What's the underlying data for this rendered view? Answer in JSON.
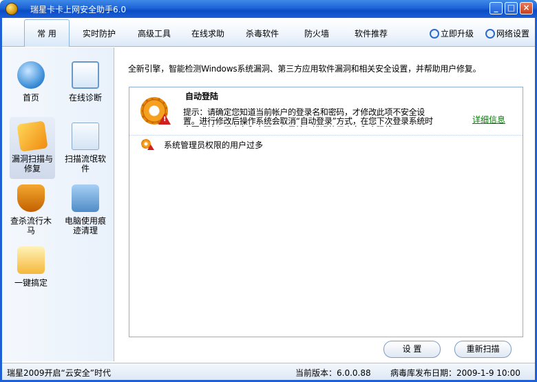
{
  "window": {
    "title": "瑞星卡卡上网安全助手6.0",
    "min_glyph": "_",
    "max_glyph": "□",
    "close_glyph": "×"
  },
  "nav": {
    "tabs": [
      {
        "label": "常  用",
        "active": true
      },
      {
        "label": "实时防护"
      },
      {
        "label": "高级工具"
      },
      {
        "label": "在线求助"
      },
      {
        "label": "杀毒软件"
      },
      {
        "label": "防火墙"
      },
      {
        "label": "软件推荐"
      }
    ],
    "upgrade_label": "立即升级",
    "network_label": "网络设置"
  },
  "sidebar": {
    "items": [
      {
        "label": "首页",
        "icon": "home-icon"
      },
      {
        "label": "在线诊断",
        "icon": "diagnosis-icon"
      },
      {
        "label": "漏洞扫描与修复",
        "icon": "vulnerability-scan-icon",
        "active": true
      },
      {
        "label": "扫描流氓软件",
        "icon": "rogue-software-icon"
      },
      {
        "label": "查杀流行木马",
        "icon": "trojan-icon"
      },
      {
        "label": "电脑使用痕迹清理",
        "icon": "clean-traces-icon"
      },
      {
        "label": "一键搞定",
        "icon": "one-click-icon"
      }
    ]
  },
  "main": {
    "intro": "全新引擎，智能检测Windows系统漏洞、第三方应用软件漏洞和相关安全设置，并帮助用户修复。",
    "issues": [
      {
        "title": "自动登陆",
        "description": "提示：请确定您知道当前帐户的登录名和密码，才修改此项不安全设置。进行修改后操作系统会取消“自动登录”方式，在您下次登录系统时会要求输入用户名和密码，如果输入错误的用户名和密码将...",
        "link": "详细信息"
      },
      {
        "title": "系统管理员权限的用户过多"
      }
    ],
    "settings_button": "设  置",
    "rescan_button": "重新扫描"
  },
  "status": {
    "slogan": "瑞星2009开启“云安全”时代",
    "version": "当前版本：6.0.0.88",
    "virus_db_date": "病毒库发布日期：2009-1-9 10:00"
  }
}
